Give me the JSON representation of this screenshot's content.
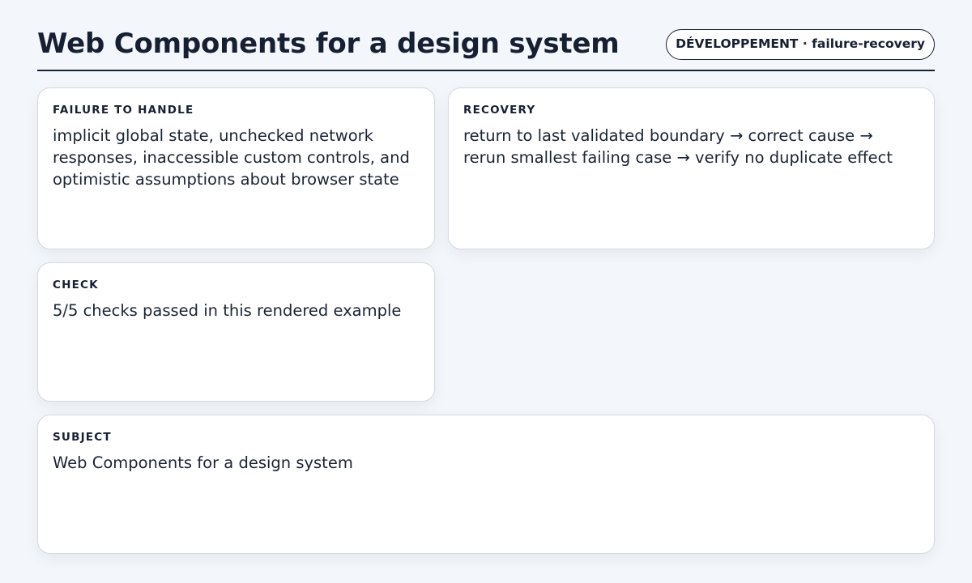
{
  "header": {
    "title": "Web Components for a design system",
    "badge": "DÉVELOPPEMENT · failure-recovery"
  },
  "cards": {
    "failure": {
      "label": "FAILURE TO HANDLE",
      "body": "implicit global state, unchecked network responses, inaccessible custom controls, and optimistic assumptions about browser state"
    },
    "recovery": {
      "label": "RECOVERY",
      "body": "return to last validated boundary → correct cause → rerun smallest failing case → verify no duplicate effect"
    },
    "check": {
      "label": "CHECK",
      "body": "5/5 checks passed in this rendered example"
    },
    "subject": {
      "label": "SUBJECT",
      "body": "Web Components for a design system"
    }
  }
}
